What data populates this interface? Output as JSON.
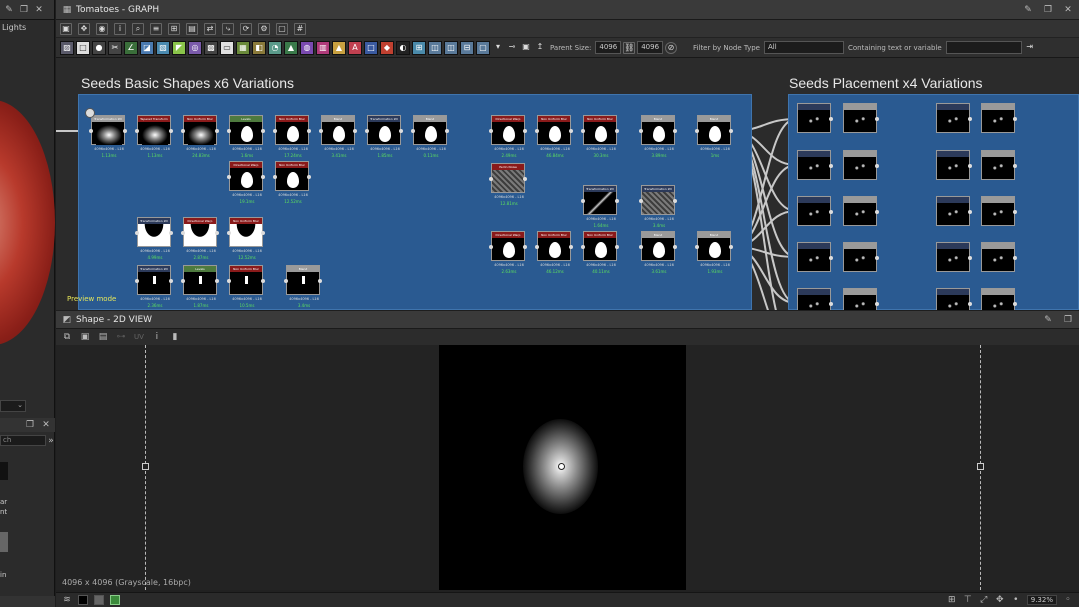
{
  "left_panel": {
    "lights_label": "Lights",
    "search_placeholder": "ch",
    "item_text_1": "ar",
    "item_text_2": "nt",
    "item_text_3": "in"
  },
  "graph": {
    "title": "Tomatoes - GRAPH",
    "parent_size_label": "Parent Size:",
    "parent_size_value": "4096",
    "size_value_2": "4096",
    "filter_label": "Filter by Node Type",
    "filter_value": "All",
    "containing_label": "Containing text or variable",
    "frame_left_title": "Seeds Basic Shapes x6 Variations",
    "frame_right_title": "Seeds Placement x4 Variations",
    "preview_mode": "Preview mode",
    "node_resolution": "4096x4096 - L16",
    "nodes": [
      {
        "name": "Transformation 2D",
        "time": "1.13ms"
      },
      {
        "name": "Tapered Transform",
        "time": "1.13ms"
      },
      {
        "name": "Non Uniform Blur",
        "time": "24.83ms"
      },
      {
        "name": "Levels",
        "time": "1.6ms"
      },
      {
        "name": "Non Uniform Blur",
        "time": "17.24ms"
      },
      {
        "name": "Blend",
        "time": "3.41ms"
      },
      {
        "name": "Transformation 2D",
        "time": "1.85ms"
      },
      {
        "name": "Blend",
        "time": "0.11ms"
      },
      {
        "name": "Directional Warp",
        "time": "19.1ms"
      },
      {
        "name": "Non Uniform Blur",
        "time": "12.52ms"
      },
      {
        "name": "Transformation 2D",
        "time": "4.99ms"
      },
      {
        "name": "Directional Warp",
        "time": "2.87ms"
      },
      {
        "name": "Non Uniform Blur",
        "time": "12.52ms"
      },
      {
        "name": "Transformation 2D",
        "time": "2.36ms"
      },
      {
        "name": "Levels",
        "time": "1.87ms"
      },
      {
        "name": "Non Uniform Blur",
        "time": "10.5ms"
      },
      {
        "name": "Blend",
        "time": "3.4ms"
      },
      {
        "name": "Directional Warp",
        "time": "2.49ms"
      },
      {
        "name": "Non Uniform Blur",
        "time": "46.84ms"
      },
      {
        "name": "Non Uniform Blur",
        "time": "30.3ms"
      },
      {
        "name": "Blend",
        "time": "3.89ms"
      },
      {
        "name": "Blend",
        "time": "1ms"
      },
      {
        "name": "Perlin Noise",
        "time": "12.81ms"
      },
      {
        "name": "Transformation 2D",
        "time": "1.64ms"
      },
      {
        "name": "Transformation 2D",
        "time": "3.4ms"
      },
      {
        "name": "Directional Warp",
        "time": "2.63ms"
      },
      {
        "name": "Non Uniform Blur",
        "time": "46.12ms"
      },
      {
        "name": "Non Uniform Blur",
        "time": "40.11ms"
      },
      {
        "name": "Blend",
        "time": "3.61ms"
      },
      {
        "name": "Blend",
        "time": "1.93ms"
      }
    ]
  },
  "view": {
    "title": "Shape - 2D VIEW",
    "uv_label": "UV",
    "status": "4096 x 4096 (Grayscale, 16bpc)",
    "zoom": "9.32%"
  }
}
